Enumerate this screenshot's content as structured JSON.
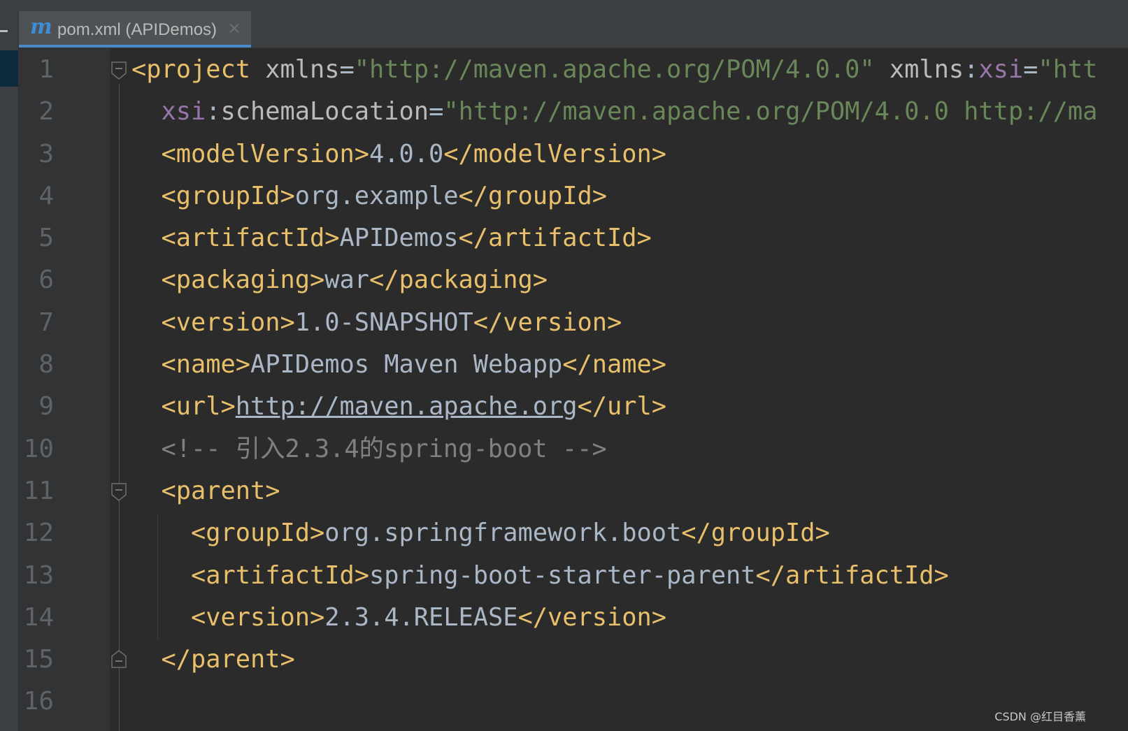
{
  "tab": {
    "icon": "maven-icon",
    "icon_glyph": "m",
    "label": "pom.xml (APIDemos)",
    "close_glyph": "×"
  },
  "lines": [
    {
      "num": "1",
      "parts": [
        {
          "t": "<project ",
          "c": "tag"
        },
        {
          "t": "xmlns",
          "c": "attr"
        },
        {
          "t": "=",
          "c": "txt"
        },
        {
          "t": "\"http://maven.apache.org/POM/4.0.0\"",
          "c": "val"
        },
        {
          "t": " ",
          "c": "txt"
        },
        {
          "t": "xmlns",
          "c": "attr"
        },
        {
          "t": ":",
          "c": "txt"
        },
        {
          "t": "xsi",
          "c": "ns"
        },
        {
          "t": "=",
          "c": "txt"
        },
        {
          "t": "\"htt",
          "c": "val"
        }
      ]
    },
    {
      "num": "2",
      "parts": [
        {
          "t": "  ",
          "c": "txt"
        },
        {
          "t": "xsi",
          "c": "ns"
        },
        {
          "t": ":",
          "c": "txt"
        },
        {
          "t": "schemaLocation",
          "c": "attr"
        },
        {
          "t": "=",
          "c": "txt"
        },
        {
          "t": "\"http://maven.apache.org/POM/4.0.0 http://ma",
          "c": "val"
        }
      ]
    },
    {
      "num": "3",
      "parts": [
        {
          "t": "  ",
          "c": "txt"
        },
        {
          "t": "<modelVersion>",
          "c": "tag"
        },
        {
          "t": "4.0.0",
          "c": "txt"
        },
        {
          "t": "</modelVersion>",
          "c": "tag"
        }
      ]
    },
    {
      "num": "4",
      "parts": [
        {
          "t": "  ",
          "c": "txt"
        },
        {
          "t": "<groupId>",
          "c": "tag"
        },
        {
          "t": "org.example",
          "c": "txt"
        },
        {
          "t": "</groupId>",
          "c": "tag"
        }
      ]
    },
    {
      "num": "5",
      "parts": [
        {
          "t": "  ",
          "c": "txt"
        },
        {
          "t": "<artifactId>",
          "c": "tag"
        },
        {
          "t": "APIDemos",
          "c": "txt"
        },
        {
          "t": "</artifactId>",
          "c": "tag"
        }
      ]
    },
    {
      "num": "6",
      "parts": [
        {
          "t": "  ",
          "c": "txt"
        },
        {
          "t": "<packaging>",
          "c": "tag"
        },
        {
          "t": "war",
          "c": "txt"
        },
        {
          "t": "</packaging>",
          "c": "tag"
        }
      ]
    },
    {
      "num": "7",
      "parts": [
        {
          "t": "  ",
          "c": "txt"
        },
        {
          "t": "<version>",
          "c": "tag"
        },
        {
          "t": "1.0-SNAPSHOT",
          "c": "txt"
        },
        {
          "t": "</version>",
          "c": "tag"
        }
      ]
    },
    {
      "num": "8",
      "parts": [
        {
          "t": "  ",
          "c": "txt"
        },
        {
          "t": "<name>",
          "c": "tag"
        },
        {
          "t": "APIDemos Maven Webapp",
          "c": "txt"
        },
        {
          "t": "</name>",
          "c": "tag"
        }
      ]
    },
    {
      "num": "9",
      "parts": [
        {
          "t": "  ",
          "c": "txt"
        },
        {
          "t": "<url>",
          "c": "tag"
        },
        {
          "t": "http://maven.apache.org",
          "c": "url"
        },
        {
          "t": "</url>",
          "c": "tag"
        }
      ]
    },
    {
      "num": "10",
      "parts": [
        {
          "t": "  ",
          "c": "txt"
        },
        {
          "t": "<!-- 引入2.3.4的spring-boot -->",
          "c": "cmt"
        }
      ]
    },
    {
      "num": "11",
      "parts": [
        {
          "t": "  ",
          "c": "txt"
        },
        {
          "t": "<parent>",
          "c": "tag"
        }
      ]
    },
    {
      "num": "12",
      "parts": [
        {
          "t": "    ",
          "c": "txt"
        },
        {
          "t": "<groupId>",
          "c": "tag"
        },
        {
          "t": "org.springframework.boot",
          "c": "txt"
        },
        {
          "t": "</groupId>",
          "c": "tag"
        }
      ]
    },
    {
      "num": "13",
      "parts": [
        {
          "t": "    ",
          "c": "txt"
        },
        {
          "t": "<artifactId>",
          "c": "tag"
        },
        {
          "t": "spring-boot-starter-parent",
          "c": "txt"
        },
        {
          "t": "</artifactId>",
          "c": "tag"
        }
      ]
    },
    {
      "num": "14",
      "parts": [
        {
          "t": "    ",
          "c": "txt"
        },
        {
          "t": "<version>",
          "c": "tag"
        },
        {
          "t": "2.3.4.RELEASE",
          "c": "txt"
        },
        {
          "t": "</version>",
          "c": "tag"
        }
      ]
    },
    {
      "num": "15",
      "parts": [
        {
          "t": "  ",
          "c": "txt"
        },
        {
          "t": "</parent>",
          "c": "tag"
        }
      ]
    },
    {
      "num": "16",
      "parts": []
    }
  ],
  "colors": {
    "background": "#2b2b2b",
    "tag": "#e8bf6a",
    "attribute": "#bababa",
    "namespace": "#9876aa",
    "string": "#6a8759",
    "text": "#a9b7c6",
    "comment": "#808080",
    "tab_underline": "#4a88c7"
  },
  "watermark": "CSDN @红目香薰"
}
